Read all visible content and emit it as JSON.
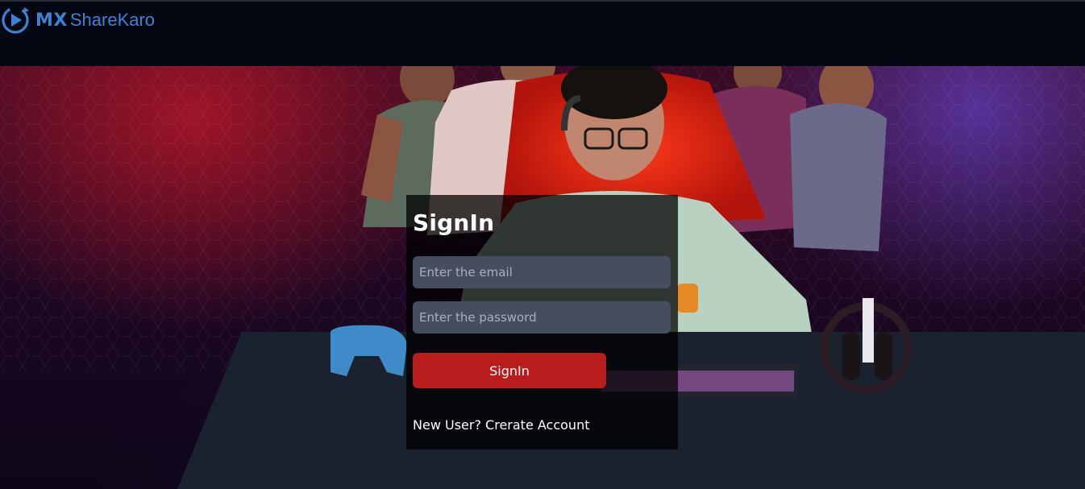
{
  "header": {
    "logo_mx": "MX",
    "logo_brand": "ShareKaro"
  },
  "signin": {
    "title": "SignIn",
    "email_placeholder": "Enter the email",
    "email_value": "",
    "password_placeholder": "Enter the password",
    "password_value": "",
    "button_label": "SignIn",
    "new_user_text": "New User?",
    "create_account_link": "Crerate Account"
  },
  "theme": {
    "header_bg": "#040812",
    "brand_blue": "#3b82d6",
    "button_red": "#b91c1c",
    "field_bg": "#454e5e"
  },
  "icons": [
    "play-circle-logo-icon"
  ]
}
